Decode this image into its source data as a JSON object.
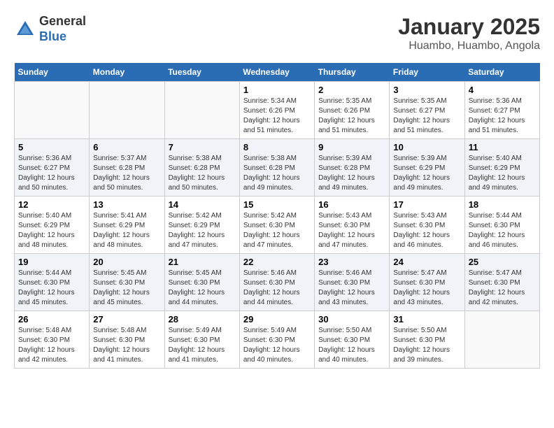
{
  "header": {
    "logo_line1": "General",
    "logo_line2": "Blue",
    "month": "January 2025",
    "location": "Huambo, Huambo, Angola"
  },
  "days_of_week": [
    "Sunday",
    "Monday",
    "Tuesday",
    "Wednesday",
    "Thursday",
    "Friday",
    "Saturday"
  ],
  "weeks": [
    [
      {
        "day": "",
        "info": ""
      },
      {
        "day": "",
        "info": ""
      },
      {
        "day": "",
        "info": ""
      },
      {
        "day": "1",
        "info": "Sunrise: 5:34 AM\nSunset: 6:26 PM\nDaylight: 12 hours\nand 51 minutes."
      },
      {
        "day": "2",
        "info": "Sunrise: 5:35 AM\nSunset: 6:26 PM\nDaylight: 12 hours\nand 51 minutes."
      },
      {
        "day": "3",
        "info": "Sunrise: 5:35 AM\nSunset: 6:27 PM\nDaylight: 12 hours\nand 51 minutes."
      },
      {
        "day": "4",
        "info": "Sunrise: 5:36 AM\nSunset: 6:27 PM\nDaylight: 12 hours\nand 51 minutes."
      }
    ],
    [
      {
        "day": "5",
        "info": "Sunrise: 5:36 AM\nSunset: 6:27 PM\nDaylight: 12 hours\nand 50 minutes."
      },
      {
        "day": "6",
        "info": "Sunrise: 5:37 AM\nSunset: 6:28 PM\nDaylight: 12 hours\nand 50 minutes."
      },
      {
        "day": "7",
        "info": "Sunrise: 5:38 AM\nSunset: 6:28 PM\nDaylight: 12 hours\nand 50 minutes."
      },
      {
        "day": "8",
        "info": "Sunrise: 5:38 AM\nSunset: 6:28 PM\nDaylight: 12 hours\nand 49 minutes."
      },
      {
        "day": "9",
        "info": "Sunrise: 5:39 AM\nSunset: 6:28 PM\nDaylight: 12 hours\nand 49 minutes."
      },
      {
        "day": "10",
        "info": "Sunrise: 5:39 AM\nSunset: 6:29 PM\nDaylight: 12 hours\nand 49 minutes."
      },
      {
        "day": "11",
        "info": "Sunrise: 5:40 AM\nSunset: 6:29 PM\nDaylight: 12 hours\nand 49 minutes."
      }
    ],
    [
      {
        "day": "12",
        "info": "Sunrise: 5:40 AM\nSunset: 6:29 PM\nDaylight: 12 hours\nand 48 minutes."
      },
      {
        "day": "13",
        "info": "Sunrise: 5:41 AM\nSunset: 6:29 PM\nDaylight: 12 hours\nand 48 minutes."
      },
      {
        "day": "14",
        "info": "Sunrise: 5:42 AM\nSunset: 6:29 PM\nDaylight: 12 hours\nand 47 minutes."
      },
      {
        "day": "15",
        "info": "Sunrise: 5:42 AM\nSunset: 6:30 PM\nDaylight: 12 hours\nand 47 minutes."
      },
      {
        "day": "16",
        "info": "Sunrise: 5:43 AM\nSunset: 6:30 PM\nDaylight: 12 hours\nand 47 minutes."
      },
      {
        "day": "17",
        "info": "Sunrise: 5:43 AM\nSunset: 6:30 PM\nDaylight: 12 hours\nand 46 minutes."
      },
      {
        "day": "18",
        "info": "Sunrise: 5:44 AM\nSunset: 6:30 PM\nDaylight: 12 hours\nand 46 minutes."
      }
    ],
    [
      {
        "day": "19",
        "info": "Sunrise: 5:44 AM\nSunset: 6:30 PM\nDaylight: 12 hours\nand 45 minutes."
      },
      {
        "day": "20",
        "info": "Sunrise: 5:45 AM\nSunset: 6:30 PM\nDaylight: 12 hours\nand 45 minutes."
      },
      {
        "day": "21",
        "info": "Sunrise: 5:45 AM\nSunset: 6:30 PM\nDaylight: 12 hours\nand 44 minutes."
      },
      {
        "day": "22",
        "info": "Sunrise: 5:46 AM\nSunset: 6:30 PM\nDaylight: 12 hours\nand 44 minutes."
      },
      {
        "day": "23",
        "info": "Sunrise: 5:46 AM\nSunset: 6:30 PM\nDaylight: 12 hours\nand 43 minutes."
      },
      {
        "day": "24",
        "info": "Sunrise: 5:47 AM\nSunset: 6:30 PM\nDaylight: 12 hours\nand 43 minutes."
      },
      {
        "day": "25",
        "info": "Sunrise: 5:47 AM\nSunset: 6:30 PM\nDaylight: 12 hours\nand 42 minutes."
      }
    ],
    [
      {
        "day": "26",
        "info": "Sunrise: 5:48 AM\nSunset: 6:30 PM\nDaylight: 12 hours\nand 42 minutes."
      },
      {
        "day": "27",
        "info": "Sunrise: 5:48 AM\nSunset: 6:30 PM\nDaylight: 12 hours\nand 41 minutes."
      },
      {
        "day": "28",
        "info": "Sunrise: 5:49 AM\nSunset: 6:30 PM\nDaylight: 12 hours\nand 41 minutes."
      },
      {
        "day": "29",
        "info": "Sunrise: 5:49 AM\nSunset: 6:30 PM\nDaylight: 12 hours\nand 40 minutes."
      },
      {
        "day": "30",
        "info": "Sunrise: 5:50 AM\nSunset: 6:30 PM\nDaylight: 12 hours\nand 40 minutes."
      },
      {
        "day": "31",
        "info": "Sunrise: 5:50 AM\nSunset: 6:30 PM\nDaylight: 12 hours\nand 39 minutes."
      },
      {
        "day": "",
        "info": ""
      }
    ]
  ]
}
